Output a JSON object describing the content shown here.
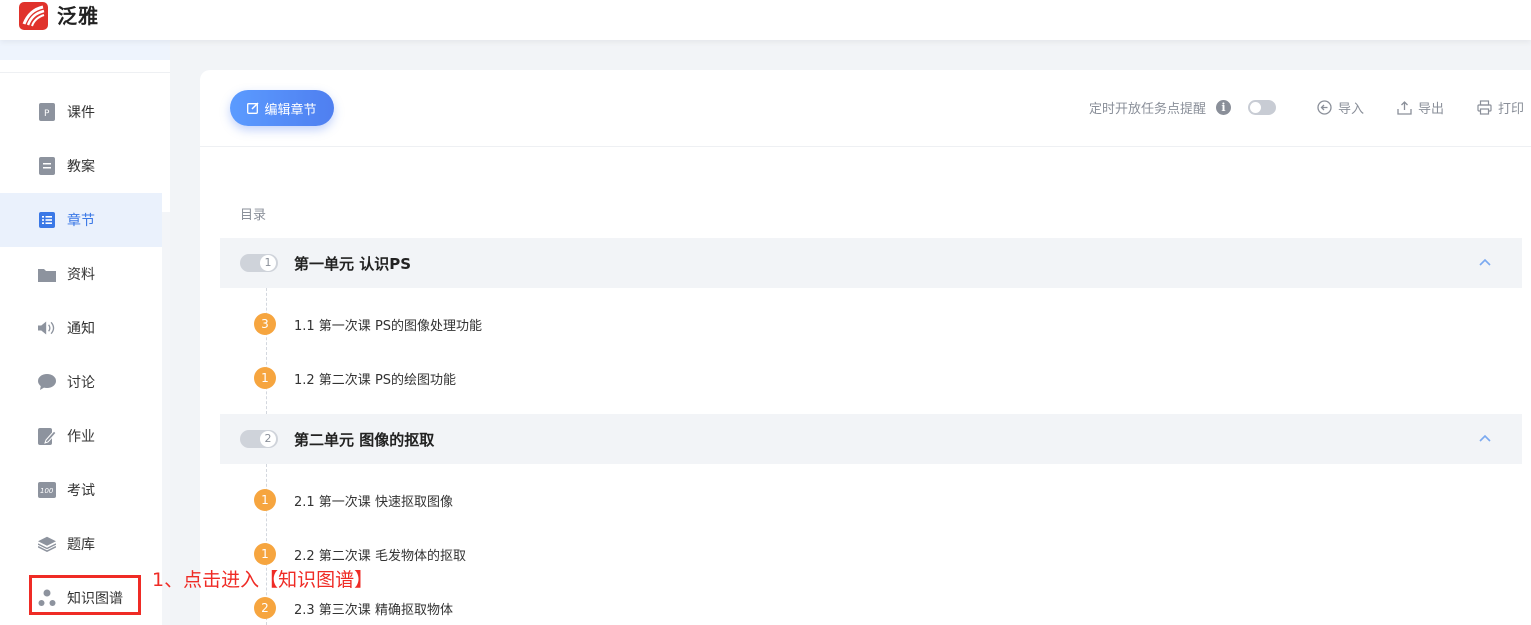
{
  "header": {
    "app_name": "泛雅",
    "logo_icon": "chaoxing-logo-icon"
  },
  "sidebar": {
    "items": [
      {
        "label": "课件",
        "icon": "courseware-icon"
      },
      {
        "label": "教案",
        "icon": "lesson-plan-icon"
      },
      {
        "label": "章节",
        "icon": "chapter-list-icon",
        "active": true
      },
      {
        "label": "资料",
        "icon": "folder-icon"
      },
      {
        "label": "通知",
        "icon": "speaker-icon"
      },
      {
        "label": "讨论",
        "icon": "chat-bubble-icon"
      },
      {
        "label": "作业",
        "icon": "homework-edit-icon"
      },
      {
        "label": "考试",
        "icon": "exam-score-icon"
      },
      {
        "label": "题库",
        "icon": "layers-icon"
      },
      {
        "label": "知识图谱",
        "icon": "knowledge-graph-icon"
      }
    ],
    "active_color": "#3a78e6"
  },
  "annotation": {
    "text": "1、点击进入【知识图谱】",
    "color": "#ef2b25"
  },
  "toolbar": {
    "edit_button": "编辑章节",
    "timed_open_label": "定时开放任务点提醒",
    "timed_open_enabled": false,
    "import_label": "导入",
    "export_label": "导出",
    "print_label": "打印"
  },
  "catalog": {
    "label": "目录",
    "units": [
      {
        "number": "1",
        "title": "第一单元 认识PS",
        "lessons": [
          {
            "count": "3",
            "title": "1.1 第一次课 PS的图像处理功能"
          },
          {
            "count": "1",
            "title": "1.2 第二次课 PS的绘图功能"
          }
        ]
      },
      {
        "number": "2",
        "title": "第二单元 图像的抠取",
        "lessons": [
          {
            "count": "1",
            "title": "2.1 第一次课 快速抠取图像"
          },
          {
            "count": "1",
            "title": "2.2 第二次课 毛发物体的抠取"
          },
          {
            "count": "2",
            "title": "2.3 第三次课 精确抠取物体"
          }
        ]
      }
    ]
  },
  "colors": {
    "accent": "#4f7ff0",
    "task_badge": "#f6a53f",
    "logo": "#e0322b"
  }
}
